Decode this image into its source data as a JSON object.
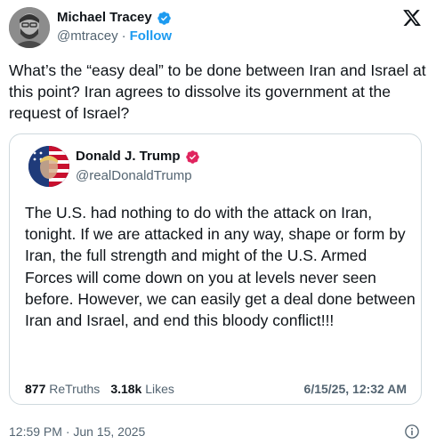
{
  "author": {
    "name": "Michael Tracey",
    "handle": "@mtracey",
    "separator": "·",
    "follow_label": "Follow",
    "verified_color": "#1d9bf0"
  },
  "tweet": {
    "text": "What’s the “easy deal” to be done between Iran and Israel at this point? Iran agrees to dissolve its government at the request of Israel?",
    "timestamp": "12:59 PM · Jun 15, 2025"
  },
  "quoted": {
    "name": "Donald J. Trump",
    "handle": "@realDonaldTrump",
    "badge_color": "#e0245e",
    "text": "The U.S. had nothing to do with the attack on Iran, tonight. If we are attacked in any way, shape or form by Iran, the full strength and might of the U.S. Armed Forces will come down on you at levels never seen before. However, we can easily get a deal done between Iran and Israel, and end this bloody conflict!!!",
    "retruths_count": "877",
    "retruths_label": "ReTruths",
    "likes_count": "3.18k",
    "likes_label": "Likes",
    "date": "6/15/25, 12:32 AM"
  },
  "icons": {
    "brand": "x-logo-icon",
    "verified": "verified-badge-icon",
    "info": "info-icon"
  }
}
